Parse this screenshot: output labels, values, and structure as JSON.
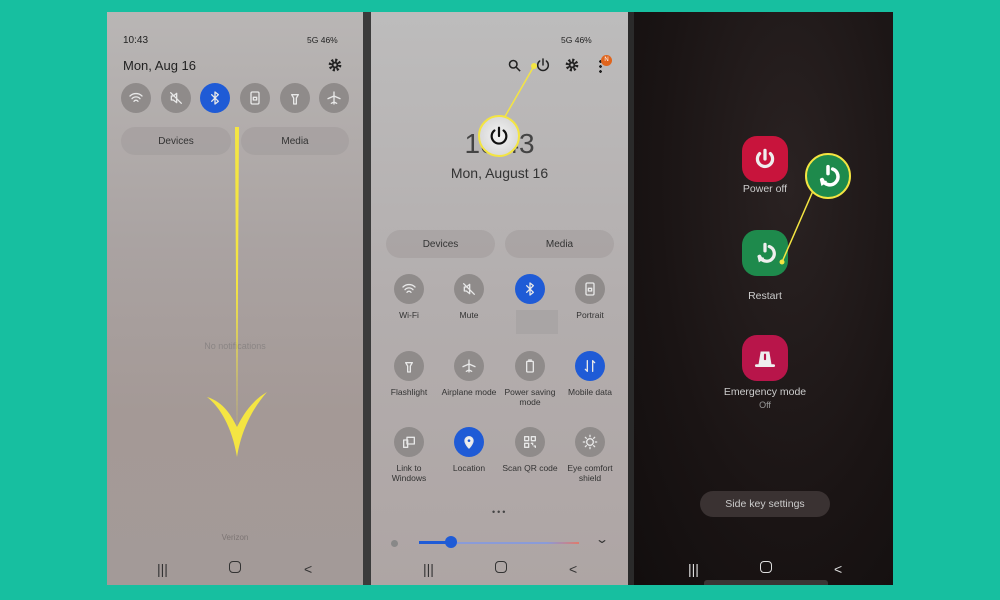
{
  "colors": {
    "background": "#17bfa0",
    "active_toggle": "#1f5bd6",
    "power_off": "#c8143c",
    "restart": "#1e8a4c",
    "highlight": "#f4e542"
  },
  "panel1": {
    "time": "10:43",
    "status": "46%",
    "network": "5G",
    "date": "Mon, Aug 16",
    "quick_toggles": [
      {
        "icon": "wifi-icon"
      },
      {
        "icon": "mute-icon"
      },
      {
        "icon": "bluetooth-icon",
        "active": true
      },
      {
        "icon": "portrait-lock-icon"
      },
      {
        "icon": "flashlight-icon"
      },
      {
        "icon": "airplane-icon"
      }
    ],
    "devices": "Devices",
    "media": "Media",
    "no_notifications": "No notifications",
    "carrier": "Verizon"
  },
  "panel2": {
    "status": "46%",
    "network": "5G",
    "notification_badge": "N",
    "clock": "10:43",
    "date": "Mon, August 16",
    "devices": "Devices",
    "media": "Media",
    "tiles": [
      {
        "label": "Wi-Fi",
        "icon": "wifi-icon",
        "active": false
      },
      {
        "label": "Mute",
        "icon": "mute-icon",
        "active": false
      },
      {
        "label": "",
        "icon": "bluetooth-icon",
        "active": true
      },
      {
        "label": "Portrait",
        "icon": "portrait-lock-icon",
        "active": false
      },
      {
        "label": "Flashlight",
        "icon": "flashlight-icon",
        "active": false
      },
      {
        "label": "Airplane mode",
        "icon": "airplane-icon",
        "active": false
      },
      {
        "label": "Power saving mode",
        "icon": "power-saving-icon",
        "active": false
      },
      {
        "label": "Mobile data",
        "icon": "mobile-data-icon",
        "active": true
      },
      {
        "label": "Link to Windows",
        "icon": "link-windows-icon",
        "active": false
      },
      {
        "label": "Location",
        "icon": "location-icon",
        "active": true
      },
      {
        "label": "Scan QR code",
        "icon": "qr-icon",
        "active": false
      },
      {
        "label": "Eye comfort shield",
        "icon": "eye-comfort-icon",
        "active": false
      }
    ],
    "page": "1 of 3",
    "brightness_percent": 15
  },
  "panel3": {
    "power_off": "Power off",
    "restart": "Restart",
    "emergency": "Emergency mode",
    "emergency_state": "Off",
    "side_key": "Side key settings"
  }
}
